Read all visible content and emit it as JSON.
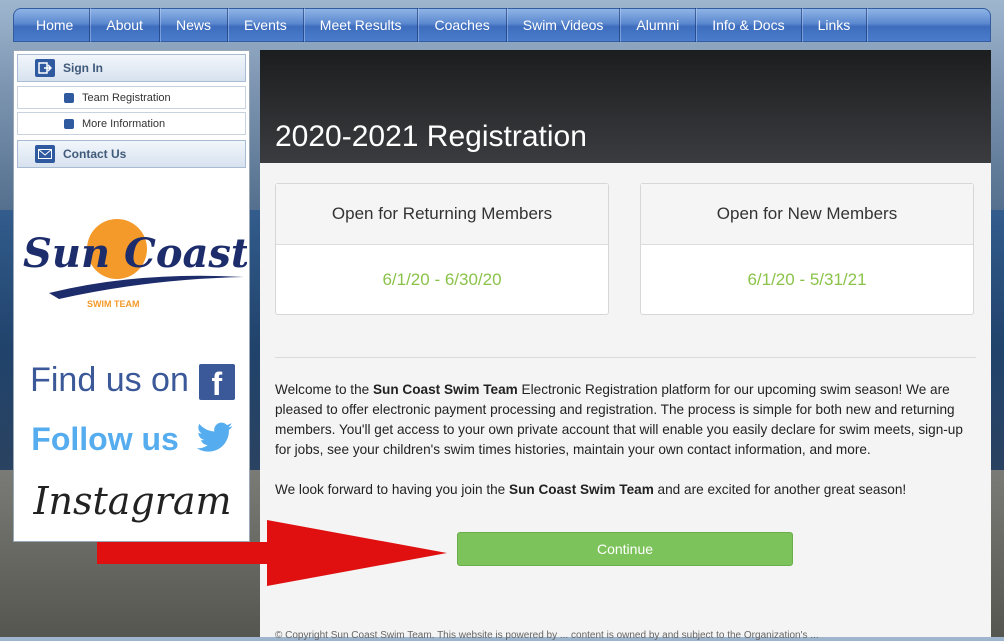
{
  "nav": {
    "items": [
      "Home",
      "About",
      "News",
      "Events",
      "Meet Results",
      "Coaches",
      "Swim Videos",
      "Alumni",
      "Info & Docs",
      "Links"
    ]
  },
  "sidebar": {
    "sign_in": "Sign In",
    "sub_items": [
      "Team Registration",
      "More Information"
    ],
    "contact": "Contact Us",
    "logo_text": "Sun Coast",
    "logo_subtext": "SWIM TEAM",
    "find_us": "Find us on",
    "follow_us": "Follow us",
    "instagram": "Instagram"
  },
  "main": {
    "title": "2020-2021 Registration",
    "cards": [
      {
        "heading": "Open for Returning Members",
        "dates": "6/1/20 - 6/30/20"
      },
      {
        "heading": "Open for New Members",
        "dates": "6/1/20 - 5/31/21"
      }
    ],
    "welcome_pre": "Welcome to the ",
    "team_name": "Sun Coast Swim Team",
    "welcome_post": " Electronic Registration platform for our upcoming swim season! We are pleased to offer electronic payment processing and registration. The process is simple for both new and returning members. You'll get access to your own private account that will enable you easily declare for swim meets, sign-up for jobs, see your children's swim times histories, maintain your own contact information, and more.",
    "closing_pre": "We look forward to having you join the ",
    "closing_post": " and are excited for another great season!",
    "continue_label": "Continue",
    "footer": "© Copyright Sun Coast Swim Team. This website is powered by ... content is owned by and subject to the Organization's ..."
  },
  "colors": {
    "nav_blue": "#4a7bcc",
    "date_green": "#8bc34a",
    "button_green": "#7dc35b",
    "arrow_red": "#e01010"
  }
}
